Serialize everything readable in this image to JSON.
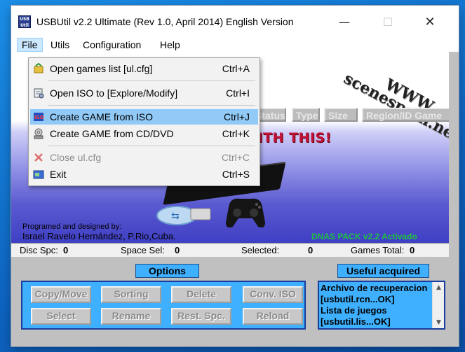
{
  "window": {
    "title": "USBUtil v2.2 Ultimate (Rev 1.0, April 2014) English Version",
    "app_icon_text": "USB Util",
    "minimize": "—",
    "maximize": "☐",
    "close": "✕"
  },
  "menubar": {
    "items": [
      "File",
      "Utils",
      "Configuration",
      "Help"
    ]
  },
  "file_menu": {
    "items": [
      {
        "label": "Open games list [ul.cfg]",
        "shortcut": "Ctrl+A",
        "icon": "open-list-icon",
        "enabled": true
      },
      {
        "label": "Open ISO to [Explore/Modify]",
        "shortcut": "Ctrl+I",
        "icon": "open-iso-icon",
        "enabled": true
      },
      {
        "label": "Create GAME from ISO",
        "shortcut": "Ctrl+J",
        "icon": "iso-icon",
        "enabled": true,
        "highlighted": true
      },
      {
        "label": "Create GAME from CD/DVD",
        "shortcut": "Ctrl+K",
        "icon": "disc-drive-icon",
        "enabled": true
      },
      {
        "label": "Close ul.cfg",
        "shortcut": "Ctrl+C",
        "icon": "close-x-icon",
        "enabled": false
      },
      {
        "label": "Exit",
        "shortcut": "Ctrl+S",
        "icon": "exit-icon",
        "enabled": true
      }
    ]
  },
  "banner": {
    "watermark": [
      "WWW.",
      "scenespain.net"
    ],
    "slogan": "WITH THIS!",
    "credits_line1": "Programed and designed by:",
    "credits_line2": "Israel Ravelo Hernández, P.Rio,Cuba.",
    "dnas": "DNAS PACK v2.2 Activado"
  },
  "columns": [
    "Status",
    "Type",
    "Size",
    "Region/ID Game"
  ],
  "statusbar": {
    "disc_spc_label": "Disc Spc:",
    "disc_spc_value": "0",
    "space_sel_label": "Space Sel:",
    "space_sel_value": "0",
    "selected_label": "Selected:",
    "selected_value": "0",
    "games_total_label": "Games Total:",
    "games_total_value": "0"
  },
  "options": {
    "title": "Options",
    "buttons": [
      "Copy/Move",
      "Sorting",
      "Delete",
      "Conv. ISO",
      "Select",
      "Rename",
      "Rest. Spc.",
      "Reload"
    ]
  },
  "useful": {
    "title": "Useful acquired",
    "items": [
      "Archivo de recuperacion",
      "[usbutil.rcn...OK]",
      "Lista de juegos",
      "[usbutil.lis...OK]"
    ]
  },
  "colors": {
    "accent_blue": "#3fb0ff",
    "menu_highlight": "#91c9f7",
    "slogan_red": "#c0123a",
    "dnas_green": "#20c040"
  }
}
